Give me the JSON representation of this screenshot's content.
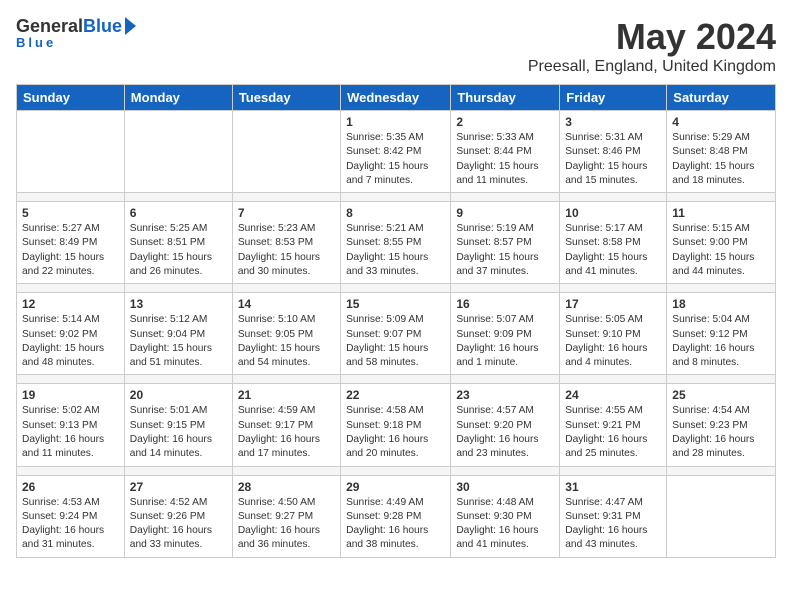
{
  "logo": {
    "general": "General",
    "blue": "Blue"
  },
  "title": "May 2024",
  "location": "Preesall, England, United Kingdom",
  "days_of_week": [
    "Sunday",
    "Monday",
    "Tuesday",
    "Wednesday",
    "Thursday",
    "Friday",
    "Saturday"
  ],
  "weeks": [
    {
      "days": [
        {
          "num": "",
          "info": ""
        },
        {
          "num": "",
          "info": ""
        },
        {
          "num": "",
          "info": ""
        },
        {
          "num": "1",
          "info": "Sunrise: 5:35 AM\nSunset: 8:42 PM\nDaylight: 15 hours\nand 7 minutes."
        },
        {
          "num": "2",
          "info": "Sunrise: 5:33 AM\nSunset: 8:44 PM\nDaylight: 15 hours\nand 11 minutes."
        },
        {
          "num": "3",
          "info": "Sunrise: 5:31 AM\nSunset: 8:46 PM\nDaylight: 15 hours\nand 15 minutes."
        },
        {
          "num": "4",
          "info": "Sunrise: 5:29 AM\nSunset: 8:48 PM\nDaylight: 15 hours\nand 18 minutes."
        }
      ]
    },
    {
      "days": [
        {
          "num": "5",
          "info": "Sunrise: 5:27 AM\nSunset: 8:49 PM\nDaylight: 15 hours\nand 22 minutes."
        },
        {
          "num": "6",
          "info": "Sunrise: 5:25 AM\nSunset: 8:51 PM\nDaylight: 15 hours\nand 26 minutes."
        },
        {
          "num": "7",
          "info": "Sunrise: 5:23 AM\nSunset: 8:53 PM\nDaylight: 15 hours\nand 30 minutes."
        },
        {
          "num": "8",
          "info": "Sunrise: 5:21 AM\nSunset: 8:55 PM\nDaylight: 15 hours\nand 33 minutes."
        },
        {
          "num": "9",
          "info": "Sunrise: 5:19 AM\nSunset: 8:57 PM\nDaylight: 15 hours\nand 37 minutes."
        },
        {
          "num": "10",
          "info": "Sunrise: 5:17 AM\nSunset: 8:58 PM\nDaylight: 15 hours\nand 41 minutes."
        },
        {
          "num": "11",
          "info": "Sunrise: 5:15 AM\nSunset: 9:00 PM\nDaylight: 15 hours\nand 44 minutes."
        }
      ]
    },
    {
      "days": [
        {
          "num": "12",
          "info": "Sunrise: 5:14 AM\nSunset: 9:02 PM\nDaylight: 15 hours\nand 48 minutes."
        },
        {
          "num": "13",
          "info": "Sunrise: 5:12 AM\nSunset: 9:04 PM\nDaylight: 15 hours\nand 51 minutes."
        },
        {
          "num": "14",
          "info": "Sunrise: 5:10 AM\nSunset: 9:05 PM\nDaylight: 15 hours\nand 54 minutes."
        },
        {
          "num": "15",
          "info": "Sunrise: 5:09 AM\nSunset: 9:07 PM\nDaylight: 15 hours\nand 58 minutes."
        },
        {
          "num": "16",
          "info": "Sunrise: 5:07 AM\nSunset: 9:09 PM\nDaylight: 16 hours\nand 1 minute."
        },
        {
          "num": "17",
          "info": "Sunrise: 5:05 AM\nSunset: 9:10 PM\nDaylight: 16 hours\nand 4 minutes."
        },
        {
          "num": "18",
          "info": "Sunrise: 5:04 AM\nSunset: 9:12 PM\nDaylight: 16 hours\nand 8 minutes."
        }
      ]
    },
    {
      "days": [
        {
          "num": "19",
          "info": "Sunrise: 5:02 AM\nSunset: 9:13 PM\nDaylight: 16 hours\nand 11 minutes."
        },
        {
          "num": "20",
          "info": "Sunrise: 5:01 AM\nSunset: 9:15 PM\nDaylight: 16 hours\nand 14 minutes."
        },
        {
          "num": "21",
          "info": "Sunrise: 4:59 AM\nSunset: 9:17 PM\nDaylight: 16 hours\nand 17 minutes."
        },
        {
          "num": "22",
          "info": "Sunrise: 4:58 AM\nSunset: 9:18 PM\nDaylight: 16 hours\nand 20 minutes."
        },
        {
          "num": "23",
          "info": "Sunrise: 4:57 AM\nSunset: 9:20 PM\nDaylight: 16 hours\nand 23 minutes."
        },
        {
          "num": "24",
          "info": "Sunrise: 4:55 AM\nSunset: 9:21 PM\nDaylight: 16 hours\nand 25 minutes."
        },
        {
          "num": "25",
          "info": "Sunrise: 4:54 AM\nSunset: 9:23 PM\nDaylight: 16 hours\nand 28 minutes."
        }
      ]
    },
    {
      "days": [
        {
          "num": "26",
          "info": "Sunrise: 4:53 AM\nSunset: 9:24 PM\nDaylight: 16 hours\nand 31 minutes."
        },
        {
          "num": "27",
          "info": "Sunrise: 4:52 AM\nSunset: 9:26 PM\nDaylight: 16 hours\nand 33 minutes."
        },
        {
          "num": "28",
          "info": "Sunrise: 4:50 AM\nSunset: 9:27 PM\nDaylight: 16 hours\nand 36 minutes."
        },
        {
          "num": "29",
          "info": "Sunrise: 4:49 AM\nSunset: 9:28 PM\nDaylight: 16 hours\nand 38 minutes."
        },
        {
          "num": "30",
          "info": "Sunrise: 4:48 AM\nSunset: 9:30 PM\nDaylight: 16 hours\nand 41 minutes."
        },
        {
          "num": "31",
          "info": "Sunrise: 4:47 AM\nSunset: 9:31 PM\nDaylight: 16 hours\nand 43 minutes."
        },
        {
          "num": "",
          "info": ""
        }
      ]
    }
  ]
}
